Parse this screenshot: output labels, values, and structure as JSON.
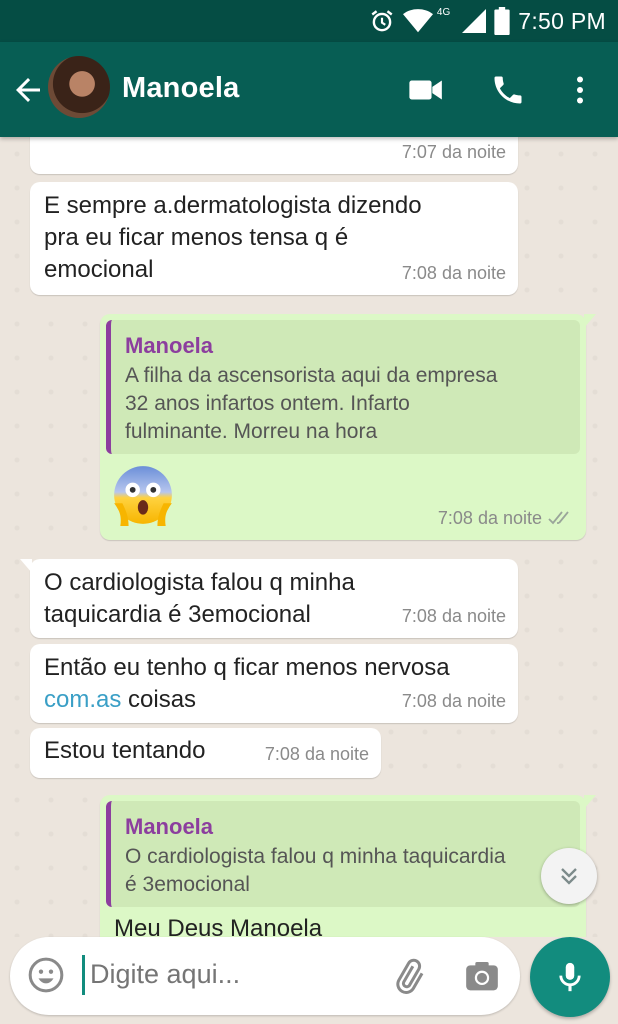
{
  "status_bar": {
    "time": "7:50 PM",
    "network": "4G",
    "icons": [
      "alarm-icon",
      "wifi-icon",
      "signal-icon",
      "battery-icon"
    ]
  },
  "header": {
    "contact_name": "Manoela",
    "icons": [
      "back-arrow-icon",
      "video-call-icon",
      "phone-icon",
      "more-vert-icon"
    ]
  },
  "messages": [
    {
      "dir": "in",
      "text": "",
      "time": "7:07 da noite"
    },
    {
      "dir": "in",
      "lines": [
        "E sempre a.dermatologista dizendo",
        "pra eu ficar menos tensa q é",
        "emocional"
      ],
      "time": "7:08 da noite"
    },
    {
      "dir": "out",
      "quote_author": "Manoela",
      "quote_lines": [
        "A filha da ascensorista aqui da empresa",
        "32 anos infartos ontem. Infarto",
        "fulminante. Morreu na hora"
      ],
      "emoji": "fearful-face-emoji",
      "time": "7:08 da noite",
      "status": "read"
    },
    {
      "dir": "in",
      "lines": [
        "O cardiologista falou q minha",
        "taquicardia é 3emocional"
      ],
      "time": "7:08 da noite"
    },
    {
      "dir": "in",
      "line1": "Então eu tenho q ficar menos nervosa",
      "link": "com.as",
      "line2_rest": " coisas",
      "time": "7:08 da noite"
    },
    {
      "dir": "in",
      "lines": [
        "Estou tentando"
      ],
      "time": "7:08 da noite"
    },
    {
      "dir": "out",
      "quote_author": "Manoela",
      "quote_lines": [
        "O cardiologista falou q minha taquicardia",
        "é 3emocional"
      ],
      "text_partial": "Meu Deus Manoela"
    }
  ],
  "input": {
    "placeholder": "Digite aqui..."
  },
  "colors": {
    "header": "#075e54",
    "status_bar": "#054d44",
    "outgoing_bubble": "#dcf8c6",
    "incoming_bubble": "#ffffff",
    "quote_accent": "#8c3e9e",
    "fab": "#128c7e",
    "link": "#3a9fc6"
  }
}
